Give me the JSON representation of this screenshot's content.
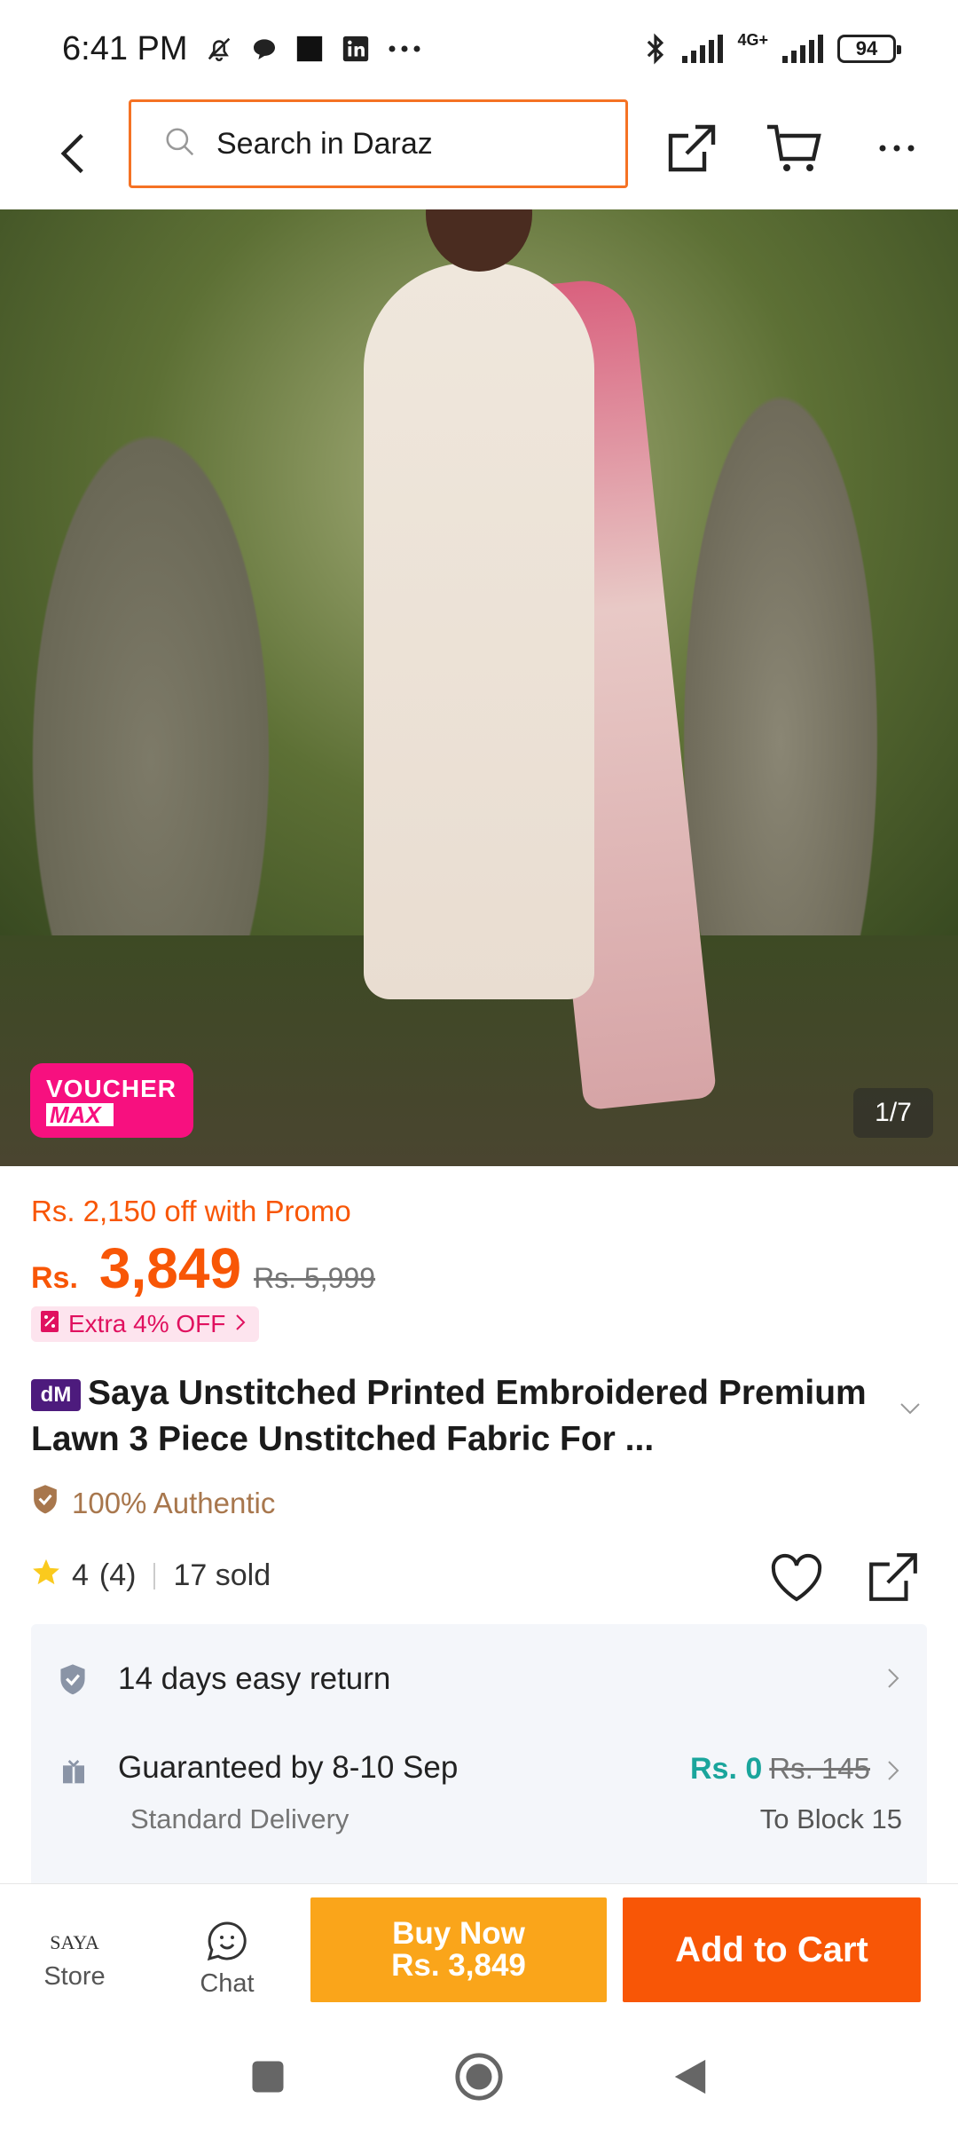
{
  "status_bar": {
    "time": "6:41 PM",
    "battery": "94",
    "network": "4G+"
  },
  "nav": {
    "search_placeholder": "Search in Daraz"
  },
  "gallery": {
    "voucher_line1": "VOUCHER",
    "voucher_line2": "MAX",
    "counter": "1/7"
  },
  "product": {
    "promo_text": "Rs. 2,150 off with Promo",
    "currency": "Rs.",
    "price": "3,849",
    "original_price": "Rs. 5,999",
    "extra_offer": "Extra 4% OFF",
    "badge": "dM",
    "title": "Saya Unstitched Printed Embroidered Premium Lawn 3 Piece Unstitched Fabric For ...",
    "authentic": "100% Authentic",
    "rating": "4",
    "rating_count": "(4)",
    "sold": "17 sold"
  },
  "info": {
    "return_label": "14 days easy return",
    "delivery_label": "Guaranteed by 8-10 Sep",
    "delivery_type": "Standard Delivery",
    "delivery_fee": "Rs. 0",
    "delivery_fee_original": "Rs. 145",
    "delivery_to": "To Block 15"
  },
  "bottom_bar": {
    "store_logo": "SAYA",
    "store_label": "Store",
    "chat_label": "Chat",
    "buy_now_line1": "Buy Now",
    "buy_now_line2": "Rs. 3,849",
    "add_to_cart": "Add to Cart"
  },
  "colors": {
    "brand_orange": "#f85606",
    "buy_now": "#faa51a",
    "voucher_pink": "#f7107f",
    "free_shipping": "#1aa59c"
  }
}
